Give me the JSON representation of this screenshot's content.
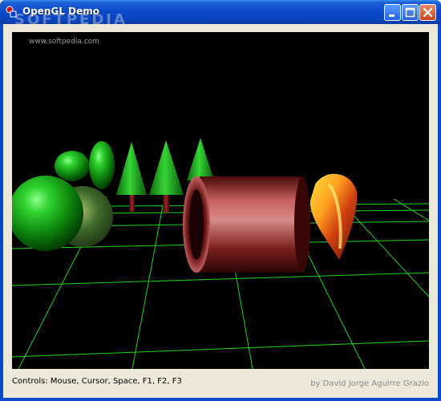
{
  "window": {
    "title": "OpenGL Demo",
    "watermark_title": "SOFTPEDIA",
    "watermark_url": "www.softpedia.com"
  },
  "caption_buttons": {
    "minimize_icon": "minimize-icon",
    "maximize_icon": "maximize-icon",
    "close_icon": "close-icon"
  },
  "footer": {
    "controls": "Controls: Mouse, Cursor, Space, F1, F2, F3",
    "credit": "by David Jorge Aguirre Grazio"
  },
  "colors": {
    "grid": "#1fd31f",
    "titlebar": "#0a49c8",
    "viewport_bg": "#000000"
  }
}
